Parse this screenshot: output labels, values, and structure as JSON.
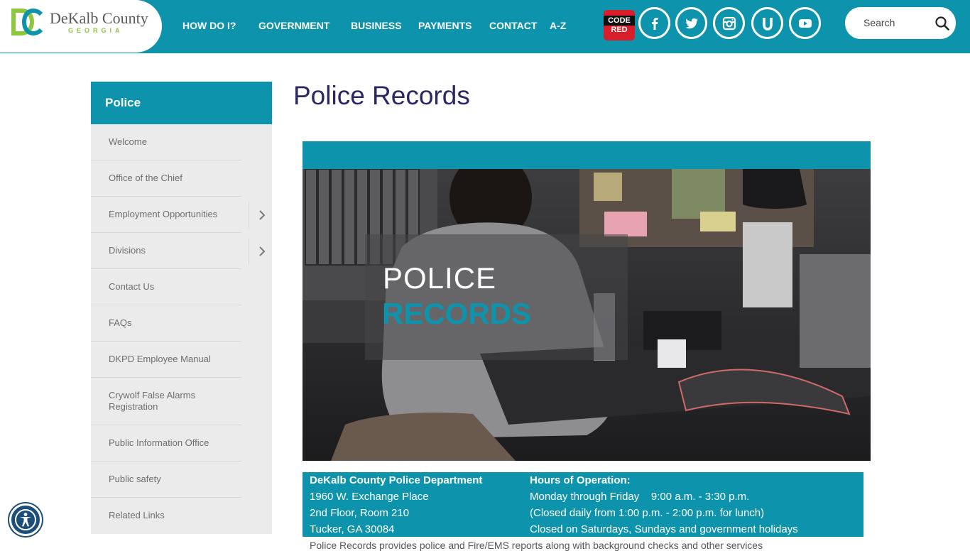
{
  "header": {
    "logo": {
      "name": "DeKalb County",
      "sub": "GEORGIA"
    },
    "nav": [
      "HOW DO I?",
      "GOVERNMENT",
      "BUSINESS",
      "PAYMENTS",
      "CONTACT",
      "A-Z"
    ],
    "codered": {
      "top": "CODE",
      "bottom": "RED"
    },
    "social": [
      "facebook-icon",
      "twitter-icon",
      "instagram-icon",
      "u-icon",
      "youtube-icon"
    ],
    "search": {
      "placeholder": "Search"
    },
    "colors": {
      "brand": "#0e93ad",
      "title": "#2a2761",
      "logo_green": "#8dc63f"
    }
  },
  "sidebar": {
    "heading": "Police",
    "items": [
      {
        "label": "Welcome",
        "has_children": false
      },
      {
        "label": "Office of the Chief",
        "has_children": false
      },
      {
        "label": "Employment Opportunities",
        "has_children": true
      },
      {
        "label": "Divisions",
        "has_children": true
      },
      {
        "label": "Contact Us",
        "has_children": false
      },
      {
        "label": "FAQs",
        "has_children": false
      },
      {
        "label": "DKPD Employee Manual",
        "has_children": false
      },
      {
        "label": "Crywolf False Alarms Registration",
        "has_children": false
      },
      {
        "label": "Public Information Office",
        "has_children": false
      },
      {
        "label": "Public safety",
        "has_children": false
      },
      {
        "label": "Related Links",
        "has_children": false
      }
    ]
  },
  "main": {
    "title": "Police Records",
    "banner": {
      "line1": "POLICE",
      "line2": "RECORDS"
    },
    "info": {
      "left": [
        "DeKalb County Police Department",
        "1960 W. Exchange Place",
        "2nd Floor, Room 210",
        "Tucker, GA 30084"
      ],
      "right": [
        "Hours of Operation:",
        "Monday through Friday    9:00 a.m. - 3:30 p.m.",
        "(Closed daily from 1:00 p.m. - 2:00 p.m. for lunch)",
        "Closed on Saturdays, Sundays and government holidays"
      ]
    },
    "trailing_text": "Police Records provides police and Fire/EMS reports along with background checks and other services"
  },
  "accessibility": {
    "icon": "accessibility-icon"
  }
}
